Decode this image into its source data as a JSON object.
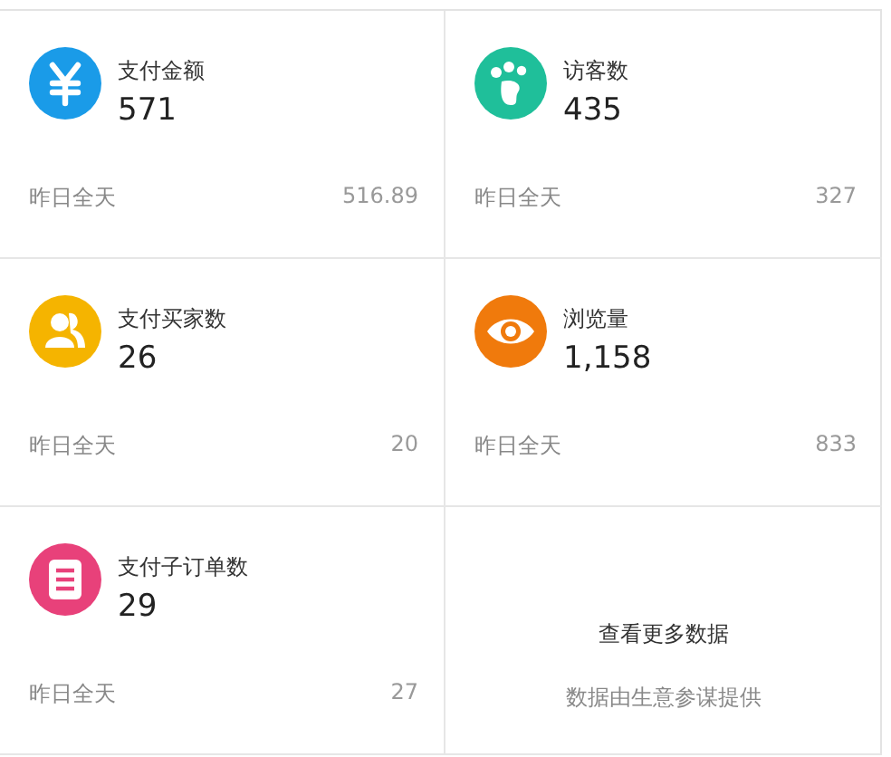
{
  "metrics": [
    {
      "kind": "yuan",
      "color": "#1a9be8",
      "label": "支付金额",
      "value": "571",
      "period": "昨日全天",
      "previous": "516.89"
    },
    {
      "kind": "footprint",
      "color": "#1fbf9a",
      "label": "访客数",
      "value": "435",
      "period": "昨日全天",
      "previous": "327"
    },
    {
      "kind": "people",
      "color": "#f5b400",
      "label": "支付买家数",
      "value": "26",
      "period": "昨日全天",
      "previous": "20"
    },
    {
      "kind": "eye",
      "color": "#f07a0c",
      "label": "浏览量",
      "value": "1,158",
      "period": "昨日全天",
      "previous": "833"
    },
    {
      "kind": "order",
      "color": "#e8417a",
      "label": "支付子订单数",
      "value": "29",
      "period": "昨日全天",
      "previous": "27"
    }
  ],
  "more": {
    "link": "查看更多数据",
    "source": "数据由生意参谋提供"
  }
}
